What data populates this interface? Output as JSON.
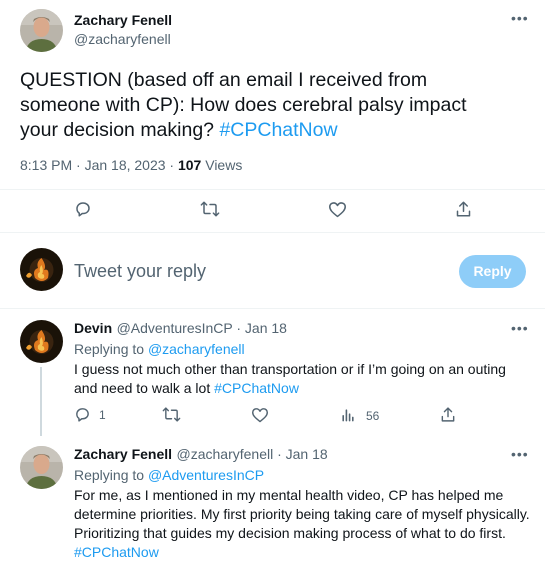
{
  "main_tweet": {
    "author_name": "Zachary Fenell",
    "author_handle": "@zacharyfenell",
    "text": "QUESTION (based off an email I received from someone with CP): How does cerebral palsy impact your decision making? ",
    "hashtag": "#CPChatNow",
    "timestamp": "8:13 PM · Jan 18, 2023 · ",
    "views_count": "107",
    "views_label": " Views"
  },
  "composer": {
    "placeholder": "Tweet your reply",
    "reply_button": "Reply"
  },
  "replies": [
    {
      "author_name": "Devin",
      "author_handle": "@AdventuresInCP",
      "date": " · Jan 18",
      "replying_to_label": "Replying to ",
      "replying_to_handle": "@zacharyfenell",
      "text": "I guess not much other than transportation or if I’m going on an outing and need to walk a lot ",
      "hashtag": "#CPChatNow",
      "reply_count": "1",
      "view_count": "56"
    },
    {
      "author_name": "Zachary Fenell",
      "author_handle": "@zacharyfenell",
      "date": " · Jan 18",
      "replying_to_label": "Replying to ",
      "replying_to_handle": "@AdventuresInCP",
      "text": "For me, as I mentioned in my mental health video, CP has helped me determine priorities. My first priority being taking care of myself physically. Prioritizing that guides my decision making process of what to do first.",
      "hashtag": "#CPChatNow"
    }
  ],
  "colors": {
    "accent": "#1d9bf0",
    "reply_button_disabled": "#8ecdf8",
    "muted_text": "#536471",
    "divider": "#eff3f4"
  },
  "icons": [
    "more-icon",
    "reply-icon",
    "retweet-icon",
    "like-icon",
    "share-icon",
    "views-icon"
  ]
}
